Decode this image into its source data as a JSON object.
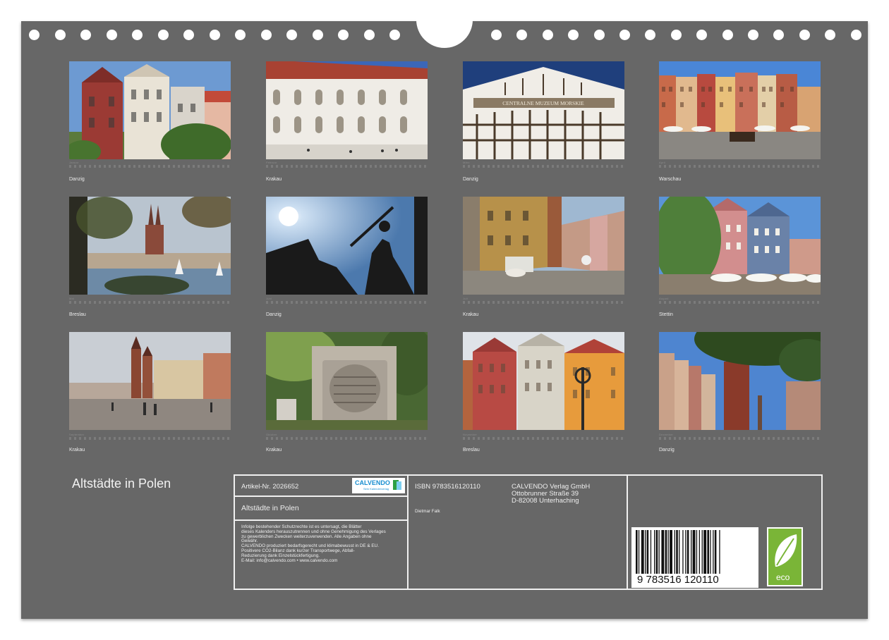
{
  "calendar_title": "Altstädte in Polen",
  "months": [
    {
      "month": "Januar",
      "city": "Danzig"
    },
    {
      "month": "Februar",
      "city": "Krakau"
    },
    {
      "month": "März",
      "city": "Danzig"
    },
    {
      "month": "April",
      "city": "Warschau"
    },
    {
      "month": "Mai",
      "city": "Breslau"
    },
    {
      "month": "Juni",
      "city": "Danzig"
    },
    {
      "month": "Juli",
      "city": "Krakau"
    },
    {
      "month": "August",
      "city": "Stettin"
    },
    {
      "month": "September",
      "city": "Krakau"
    },
    {
      "month": "Oktober",
      "city": "Krakau"
    },
    {
      "month": "November",
      "city": "Breslau"
    },
    {
      "month": "Dezember",
      "city": "Danzig"
    }
  ],
  "museum_sign": "CENTRALNE MUZEUM MORSKIE",
  "info": {
    "article": "Artikel-Nr. 2026652",
    "logo_text": "CALVENDO",
    "logo_sub": "Sein Kalenderverlag",
    "title": "Altstädte in Polen",
    "legal": "Infolge bestehender Schutzrechte ist es untersagt, die Blätter\ndieses Kalenders herauszutrennen und ohne Genehmigung des Verlages\nzu gewerblichen Zwecken weiterzuverwenden. Alle Angaben ohne\nGewähr.\nCALVENDO produziert bedarfsgerecht und klimabewusst in DE & EU.\nPositivere CO2-Bilanz dank kurzer Transportwege, Abfall-\nReduzierung dank Einzelstückfertigung.\nE-Mail: info@calvendo.com • www.calvendo.com",
    "isbn": "ISBN 9783516120110",
    "author": "Dietmar Falk",
    "publisher_name": "CALVENDO Verlag GmbH",
    "publisher_street": "Ottobrunner Straße 39",
    "publisher_city": "D-82008 Unterhaching",
    "barcode_digits": "9   783516   120110",
    "eco_label": "eco"
  },
  "colors": {
    "background": "#676767",
    "text": "#eeeeee",
    "eco_green": "#7ab537"
  }
}
